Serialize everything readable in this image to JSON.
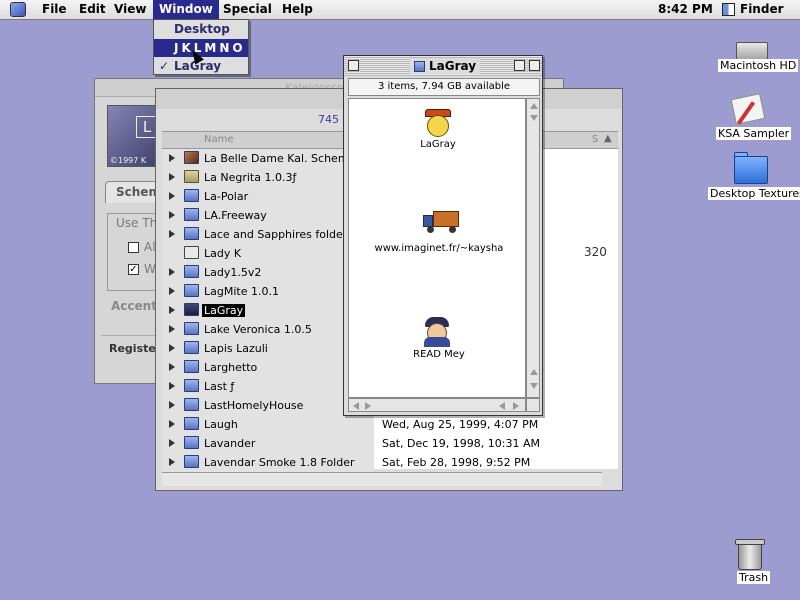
{
  "menubar": {
    "menus": [
      "File",
      "Edit",
      "View",
      "Window",
      "Special",
      "Help"
    ],
    "clock": "8:42 PM",
    "app": "Finder"
  },
  "window_menu": {
    "items": [
      "Desktop",
      "JKLMNO",
      "LaGray"
    ],
    "checked": "LaGray"
  },
  "desktop": {
    "icons": [
      "Macintosh HD",
      "KSA Sampler",
      "Desktop Textures",
      "Trash"
    ]
  },
  "control_panel": {
    "title": "Kaleidoscope",
    "copyright": "©1997 K",
    "tab": "Scheme",
    "group": "Use Th",
    "opt1": "Al",
    "opt2": "W",
    "accent": "Accent",
    "register": "Register"
  },
  "list_window": {
    "info": "745 i",
    "col_name": "Name",
    "col_size": "S",
    "size_visible": "320",
    "items": [
      {
        "name": "La Belle Dame Kal. Scheme",
        "date": ""
      },
      {
        "name": "La Negrita 1.0.3ƒ",
        "date": ""
      },
      {
        "name": "La-Polar",
        "date": ""
      },
      {
        "name": "LA.Freeway",
        "date": ""
      },
      {
        "name": "Lace and Sapphires folder",
        "date": ""
      },
      {
        "name": "Lady K",
        "date": ""
      },
      {
        "name": "Lady1.5v2",
        "date": ""
      },
      {
        "name": "LagMite 1.0.1",
        "date": ""
      },
      {
        "name": "LaGray",
        "date": ""
      },
      {
        "name": "Lake Veronica 1.0.5",
        "date": ""
      },
      {
        "name": "Lapis Lazuli",
        "date": ""
      },
      {
        "name": "Larghetto",
        "date": ""
      },
      {
        "name": "Last ƒ",
        "date": ""
      },
      {
        "name": "LastHomelyHouse",
        "date": ""
      },
      {
        "name": "Laugh",
        "date": "Wed, Aug 25, 1999, 4:07 PM"
      },
      {
        "name": "Lavander",
        "date": "Sat, Dec 19, 1998, 10:31 AM"
      },
      {
        "name": "Lavendar Smoke 1.8 Folder",
        "date": "Sat, Feb 28, 1998, 9:52 PM"
      }
    ]
  },
  "lagray_window": {
    "title": "LaGray",
    "summary": "3 items, 7.94 GB available",
    "items": [
      "LaGray",
      "www.imaginet.fr/~kaysha",
      "READ Mey"
    ]
  }
}
